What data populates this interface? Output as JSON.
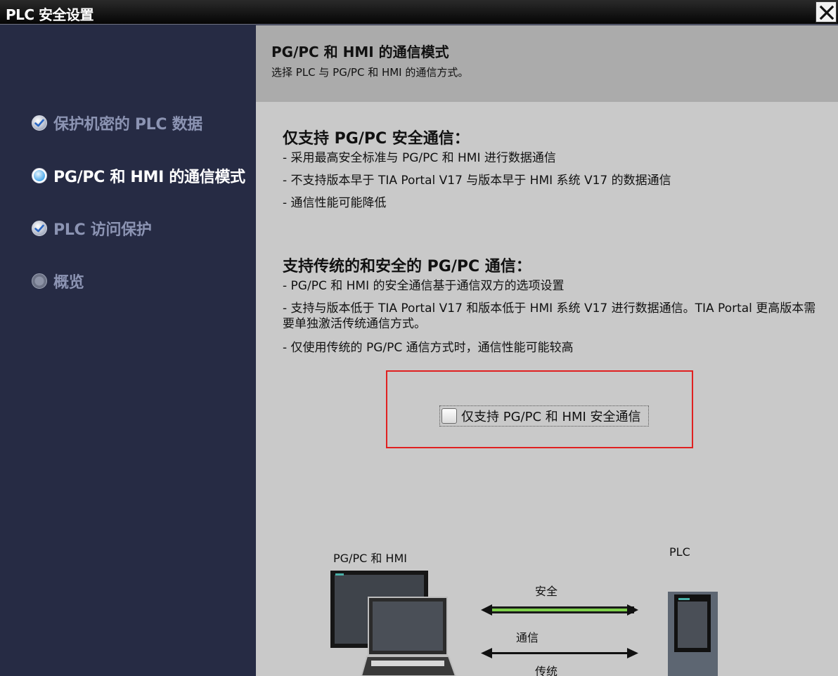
{
  "window": {
    "title": "PLC 安全设置",
    "close_icon": "close-icon"
  },
  "sidebar": {
    "items": [
      {
        "label": "保护机密的 PLC 数据",
        "icon": "check-circle-icon",
        "state": "done"
      },
      {
        "label": "PG/PC 和 HMI 的通信模式",
        "icon": "radio-active-icon",
        "state": "active"
      },
      {
        "label": "PLC 访问保护",
        "icon": "check-circle-icon",
        "state": "done"
      },
      {
        "label": "概览",
        "icon": "circle-grey-icon",
        "state": "pending"
      }
    ]
  },
  "header": {
    "title": "PG/PC 和 HMI 的通信模式",
    "subtitle": "选择 PLC 与 PG/PC 和 HMI 的通信方式。"
  },
  "section1": {
    "title": "仅支持 PG/PC 安全通信：",
    "lines": [
      "- 采用最高安全标准与 PG/PC 和 HMI 进行数据通信",
      "- 不支持版本早于 TIA Portal V17 与版本早于 HMI 系统 V17 的数据通信",
      "- 通信性能可能降低"
    ]
  },
  "section2": {
    "title": "支持传统的和安全的 PG/PC 通信：",
    "lines": [
      "- PG/PC 和 HMI 的安全通信基于通信双方的选项设置",
      "- 支持与版本低于 TIA Portal V17 和版本低于 HMI 系统 V17 进行数据通信。TIA Portal 更高版本需要单独激活传统通信方式。",
      "- 仅使用传统的 PG/PC 通信方式时，通信性能可能较高"
    ]
  },
  "checkbox": {
    "label": "仅支持 PG/PC 和 HMI 安全通信",
    "checked": false
  },
  "diagram": {
    "left_label": "PG/PC 和 HMI",
    "right_label": "PLC",
    "secure_label": "安全",
    "comm_label": "通信",
    "legacy_label": "传统",
    "secure_color": "#7ed04b"
  }
}
